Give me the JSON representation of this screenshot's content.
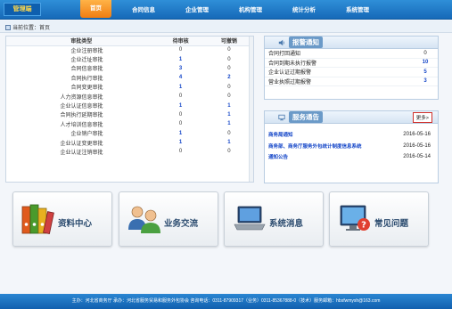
{
  "header": {
    "brand": "管理端",
    "nav": [
      "首页",
      "合同信息",
      "企业管理",
      "机构管理",
      "统计分析",
      "系统管理"
    ]
  },
  "breadcrumb": "当前位置：首页",
  "audit_table": {
    "columns": [
      "审批类型",
      "待审核",
      "可撤销"
    ],
    "rows": [
      {
        "type": "企业注册审批",
        "pending": "0",
        "revocable": "0",
        "pending_hl": false,
        "revocable_hl": false
      },
      {
        "type": "企业迁址审批",
        "pending": "1",
        "revocable": "0",
        "pending_hl": true,
        "revocable_hl": false
      },
      {
        "type": "合同信息审批",
        "pending": "3",
        "revocable": "0",
        "pending_hl": true,
        "revocable_hl": false
      },
      {
        "type": "合同执行审批",
        "pending": "4",
        "revocable": "2",
        "pending_hl": true,
        "revocable_hl": true
      },
      {
        "type": "合同变更审批",
        "pending": "1",
        "revocable": "0",
        "pending_hl": true,
        "revocable_hl": false
      },
      {
        "type": "人力资源信息审批",
        "pending": "0",
        "revocable": "0",
        "pending_hl": false,
        "revocable_hl": false
      },
      {
        "type": "企业认证信息审批",
        "pending": "1",
        "revocable": "1",
        "pending_hl": true,
        "revocable_hl": true
      },
      {
        "type": "合同执行延期审批",
        "pending": "0",
        "revocable": "1",
        "pending_hl": false,
        "revocable_hl": true
      },
      {
        "type": "人才培训信息审批",
        "pending": "0",
        "revocable": "1",
        "pending_hl": false,
        "revocable_hl": true
      },
      {
        "type": "企业销户审批",
        "pending": "1",
        "revocable": "0",
        "pending_hl": true,
        "revocable_hl": false
      },
      {
        "type": "企业认证变更审批",
        "pending": "1",
        "revocable": "1",
        "pending_hl": true,
        "revocable_hl": true
      },
      {
        "type": "企业认证注销审批",
        "pending": "0",
        "revocable": "0",
        "pending_hl": false,
        "revocable_hl": false
      }
    ]
  },
  "alerts": {
    "title": "报警通知",
    "items": [
      {
        "label": "合同打回通知",
        "value": "0",
        "hl": false
      },
      {
        "label": "合同到期未执行报警",
        "value": "10",
        "hl": true
      },
      {
        "label": "企业认证过期报警",
        "value": "5",
        "hl": true
      },
      {
        "label": "营业执照过期报警",
        "value": "3",
        "hl": true
      }
    ]
  },
  "notices": {
    "title": "服务通告",
    "more": "更多>",
    "items": [
      {
        "label": "商务局通知",
        "date": "2016-05-16"
      },
      {
        "label": "商务部、商务厅服务外包统计制度信息系统",
        "date": "2016-05-16"
      },
      {
        "label": "通知公告",
        "date": "2016-05-14"
      }
    ]
  },
  "tiles": [
    {
      "label": "资料中心",
      "icon": "binders-icon"
    },
    {
      "label": "业务交流",
      "icon": "people-icon"
    },
    {
      "label": "系统消息",
      "icon": "laptop-icon"
    },
    {
      "label": "常见问题",
      "icon": "help-monitor-icon"
    }
  ],
  "footer": "主办：河北省商务厅 承办：河北省服务贸易和服务外包协会 咨询电话：0311-87909317（业务）0311-85367888-0（技术）服务邮箱：hbsfwmysh@163.com"
}
